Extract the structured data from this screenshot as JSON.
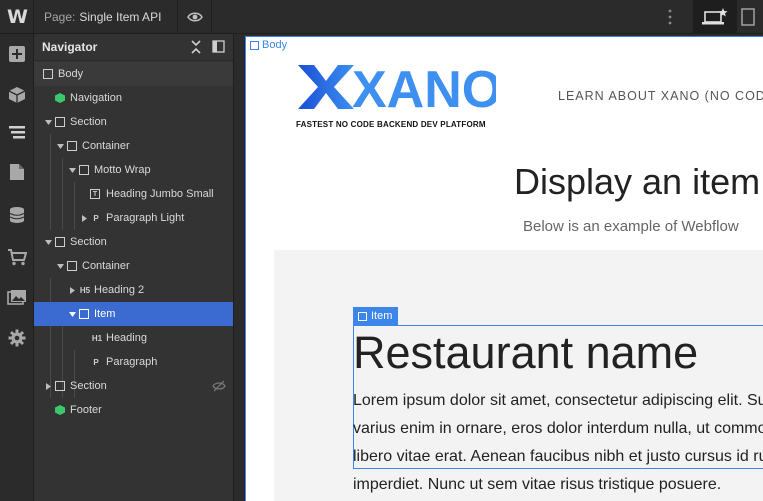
{
  "topbar": {
    "logo_letter": "W",
    "page_prefix": "Page:",
    "page_name": "Single Item API",
    "icons": [
      "eye-icon",
      "kebab-menu-icon",
      "laptop-star-icon",
      "tablet-icon"
    ]
  },
  "left_tools": [
    "add-icon",
    "cube-icon",
    "layers-icon",
    "page-icon",
    "database-icon",
    "cart-icon",
    "assets-icon",
    "settings-icon"
  ],
  "navigator": {
    "title": "Navigator",
    "items": [
      {
        "label": "Body",
        "type": "box"
      },
      {
        "label": "Navigation",
        "type": "symbol"
      },
      {
        "label": "Section",
        "type": "box"
      },
      {
        "label": "Container",
        "type": "box"
      },
      {
        "label": "Motto Wrap",
        "type": "box"
      },
      {
        "label": "Heading Jumbo Small",
        "type": "text",
        "badge": "T"
      },
      {
        "label": "Paragraph Light",
        "type": "paragraph",
        "badge": "P"
      },
      {
        "label": "Section",
        "type": "box"
      },
      {
        "label": "Container",
        "type": "box"
      },
      {
        "label": "Heading 2",
        "type": "heading",
        "badge": "H5"
      },
      {
        "label": "Item",
        "type": "box"
      },
      {
        "label": "Heading",
        "type": "heading",
        "badge": "H1"
      },
      {
        "label": "Paragraph",
        "type": "paragraph",
        "badge": "P"
      },
      {
        "label": "Section",
        "type": "box"
      },
      {
        "label": "Footer",
        "type": "symbol"
      }
    ]
  },
  "canvas": {
    "body_tag": "Body",
    "logo_text": "XANO",
    "tagline_pre": "FASTEST ",
    "tagline_bold": "NO CODE",
    "tagline_post": " BACKEND DEV PLATFORM",
    "nav_link": "LEARN ABOUT XANO (NO CODE",
    "hero_title": "Display an item",
    "hero_subtitle": "Below is an example of Webflow",
    "item_tag": "Item",
    "item_heading": "Restaurant name",
    "item_paragraph": "Lorem ipsum dolor sit amet, consectetur adipiscing elit. Suspendisse varius enim in ornare, eros dolor interdum nulla, ut commodo diam libero vitae erat. Aenean faucibus nibh et justo cursus id rutrum lorem imperdiet. Nunc ut sem vitae risus tristique posuere."
  },
  "colors": {
    "accent": "#3b6bd0",
    "canvas_blue": "#3b86e8",
    "symbol_green": "#3ec66c",
    "xano_blue_dark": "#1a4fd6",
    "xano_blue_light": "#3d8ff0"
  }
}
